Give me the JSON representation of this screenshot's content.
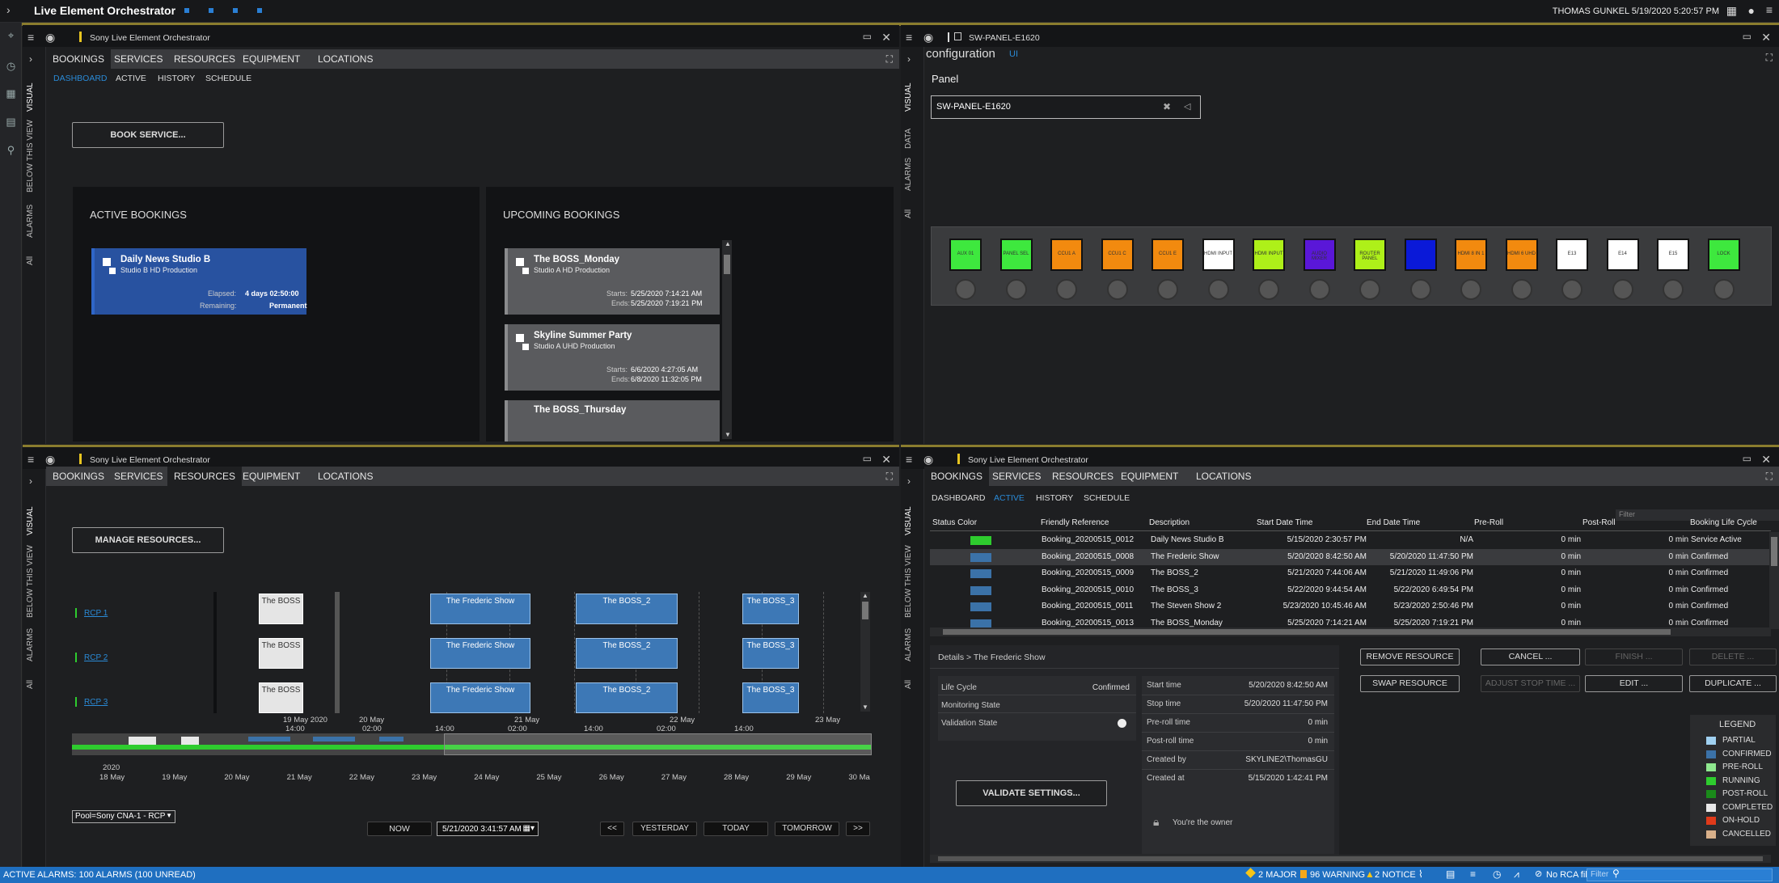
{
  "app": {
    "title": "Live Element Orchestrator",
    "user": "THOMAS GUNKEL 5/19/2020 5:20:57 PM"
  },
  "status": {
    "alarms": "ACTIVE ALARMS: 100 ALARMS (100 UNREAD)",
    "major": "2 MAJOR",
    "warning": "96 WARNING",
    "notice": "2 NOTICE",
    "rca": "No RCA filter",
    "filter_placeholder": "Filter"
  },
  "nav": [
    "BOOKINGS",
    "SERVICES",
    "RESOURCES",
    "EQUIPMENT",
    "LOCATIONS"
  ],
  "vtabs": [
    "VISUAL",
    "BELOW THIS VIEW",
    "ALARMS",
    "All"
  ],
  "vtabs_right": [
    "VISUAL",
    "DATA",
    "ALARMS",
    "All"
  ],
  "subnav": [
    "DASHBOARD",
    "ACTIVE",
    "HISTORY",
    "SCHEDULE"
  ],
  "p1": {
    "title": "Sony Live Element Orchestrator",
    "book_btn": "BOOK SERVICE...",
    "active_title": "ACTIVE BOOKINGS",
    "upcoming_title": "UPCOMING BOOKINGS",
    "active": {
      "name": "Daily News Studio B",
      "sub": "Studio B HD Production",
      "elapsed_k": "Elapsed:",
      "elapsed_v": "4 days 02:50:00",
      "remaining_k": "Remaining:",
      "remaining_v": "Permanent"
    },
    "upcoming": [
      {
        "name": "The BOSS_Monday",
        "sub": "Studio A HD Production",
        "starts": "5/25/2020 7:14:21 AM",
        "ends": "5/25/2020 7:19:21 PM"
      },
      {
        "name": "Skyline Summer Party",
        "sub": "Studio A UHD Production",
        "starts": "6/6/2020 4:27:05 AM",
        "ends": "6/8/2020 11:32:05 PM"
      },
      {
        "name": "The BOSS_Thursday",
        "sub": "",
        "starts": "",
        "ends": ""
      }
    ],
    "starts_k": "Starts:",
    "ends_k": "Ends:"
  },
  "p2": {
    "title": "SW-PANEL-E1620",
    "config": "configuration",
    "config_sub": "UI",
    "panel_label": "Panel",
    "panel_value": "SW-PANEL-E1620",
    "tiles": [
      {
        "label": "AUX 01",
        "color": "#3ee83e"
      },
      {
        "label": "PANEL SEL",
        "color": "#3ee83e"
      },
      {
        "label": "CCU1 A",
        "color": "#f28a0f"
      },
      {
        "label": "CCU1 C",
        "color": "#f28a0f"
      },
      {
        "label": "CCU1 E",
        "color": "#f28a0f"
      },
      {
        "label": "HDMI INPUT",
        "color": "#ffffff"
      },
      {
        "label": "HDMI INPUT",
        "color": "#aef019"
      },
      {
        "label": "AUDIO MIXER",
        "color": "#5a17d8"
      },
      {
        "label": "ROUTER PANEL",
        "color": "#aef019"
      },
      {
        "label": "",
        "color": "#0a19d8"
      },
      {
        "label": "HDMI 8 IN 1",
        "color": "#f28a0f"
      },
      {
        "label": "HDMI 6 UHD",
        "color": "#f28a0f"
      },
      {
        "label": "E13",
        "color": "#ffffff"
      },
      {
        "label": "E14",
        "color": "#ffffff"
      },
      {
        "label": "E15",
        "color": "#ffffff"
      },
      {
        "label": "LOCK",
        "color": "#3ee83e"
      }
    ]
  },
  "p3": {
    "title": "Sony Live Element Orchestrator",
    "manage_btn": "MANAGE RESOURCES...",
    "rcps": [
      "RCP 1",
      "RCP 2",
      "RCP 3"
    ],
    "bookings": [
      {
        "name": "The BOSS",
        "style": "grey"
      },
      {
        "name": "The Frederic Show",
        "style": "blue"
      },
      {
        "name": "The BOSS_2",
        "style": "blue"
      },
      {
        "name": "The BOSS_3",
        "style": "blue"
      }
    ],
    "day_labels_top": [
      "19 May 2020",
      "20 May",
      "21 May",
      "22 May",
      "23 May"
    ],
    "hour_labels_top": [
      "14:00",
      "02:00",
      "14:00",
      "02:00",
      "14:00",
      "02:00",
      "14:00"
    ],
    "year": "2020",
    "day_labels": [
      "18 May",
      "19 May",
      "20 May",
      "21 May",
      "22 May",
      "23 May",
      "24 May",
      "25 May",
      "26 May",
      "27 May",
      "28 May",
      "29 May",
      "30 Ma"
    ],
    "pool": "Pool=Sony CNA-1 - RCP",
    "now_btn": "NOW",
    "date_value": "5/21/2020 3:41:57 AM",
    "prev": "<<",
    "yesterday": "YESTERDAY",
    "today": "TODAY",
    "tomorrow": "TOMORROW",
    "next": ">>"
  },
  "p4": {
    "title": "Sony Live Element Orchestrator",
    "filter_placeholder": "Filter",
    "columns": [
      "Status Color",
      "Friendly Reference",
      "Description",
      "Start Date Time",
      "End Date Time",
      "Pre-Roll",
      "Post-Roll",
      "Booking Life Cycle"
    ],
    "rows": [
      {
        "color": "#2ecc2e",
        "ref": "Booking_20200515_0012",
        "desc": "Daily News Studio B",
        "start": "5/15/2020 2:30:57 PM",
        "end": "N/A",
        "pre": "0 min",
        "post": "0 min",
        "cycle": "Service Active"
      },
      {
        "color": "#3b72a8",
        "ref": "Booking_20200515_0008",
        "desc": "The Frederic Show",
        "start": "5/20/2020 8:42:50 AM",
        "end": "5/20/2020 11:47:50 PM",
        "pre": "0 min",
        "post": "0 min",
        "cycle": "Confirmed"
      },
      {
        "color": "#3b72a8",
        "ref": "Booking_20200515_0009",
        "desc": "The BOSS_2",
        "start": "5/21/2020 7:44:06 AM",
        "end": "5/21/2020 11:49:06 PM",
        "pre": "0 min",
        "post": "0 min",
        "cycle": "Confirmed"
      },
      {
        "color": "#3b72a8",
        "ref": "Booking_20200515_0010",
        "desc": "The BOSS_3",
        "start": "5/22/2020 9:44:54 AM",
        "end": "5/22/2020 6:49:54 PM",
        "pre": "0 min",
        "post": "0 min",
        "cycle": "Confirmed"
      },
      {
        "color": "#3b72a8",
        "ref": "Booking_20200515_0011",
        "desc": "The Steven Show 2",
        "start": "5/23/2020 10:45:46 AM",
        "end": "5/23/2020 2:50:46 PM",
        "pre": "0 min",
        "post": "0 min",
        "cycle": "Confirmed"
      },
      {
        "color": "#3b72a8",
        "ref": "Booking_20200515_0013",
        "desc": "The BOSS_Monday",
        "start": "5/25/2020 7:14:21 AM",
        "end": "5/25/2020 7:19:21 PM",
        "pre": "0 min",
        "post": "0 min",
        "cycle": "Confirmed"
      }
    ],
    "details_title": "Details > The Frederic Show",
    "life_cycle_k": "Life Cycle",
    "life_cycle_v": "Confirmed",
    "monitoring_k": "Monitoring State",
    "validation_k": "Validation State",
    "validate_btn": "VALIDATE SETTINGS...",
    "details": [
      {
        "k": "Start time",
        "v": "5/20/2020 8:42:50 AM"
      },
      {
        "k": "Stop time",
        "v": "5/20/2020 11:47:50 PM"
      },
      {
        "k": "Pre-roll time",
        "v": "0 min"
      },
      {
        "k": "Post-roll time",
        "v": "0 min"
      },
      {
        "k": "Created by",
        "v": "SKYLINE2\\ThomasGU"
      },
      {
        "k": "Created at",
        "v": "5/15/2020 1:42:41 PM"
      }
    ],
    "owner": "You're the owner",
    "actions": [
      "REMOVE RESOURCE",
      "CANCEL ...",
      "FINISH ...",
      "DELETE ...",
      "SWAP RESOURCE",
      "ADJUST STOP TIME ...",
      "EDIT ...",
      "DUPLICATE ..."
    ],
    "legend_title": "LEGEND",
    "legend": [
      {
        "label": "PARTIAL",
        "color": "#9fd0f0"
      },
      {
        "label": "CONFIRMED",
        "color": "#3b72a8"
      },
      {
        "label": "PRE-ROLL",
        "color": "#8fe88f"
      },
      {
        "label": "RUNNING",
        "color": "#2ecc2e"
      },
      {
        "label": "POST-ROLL",
        "color": "#1a8a1a"
      },
      {
        "label": "COMPLETED",
        "color": "#e8e8e8"
      },
      {
        "label": "ON-HOLD",
        "color": "#e03a1a"
      },
      {
        "label": "CANCELLED",
        "color": "#d8b08a"
      }
    ]
  }
}
